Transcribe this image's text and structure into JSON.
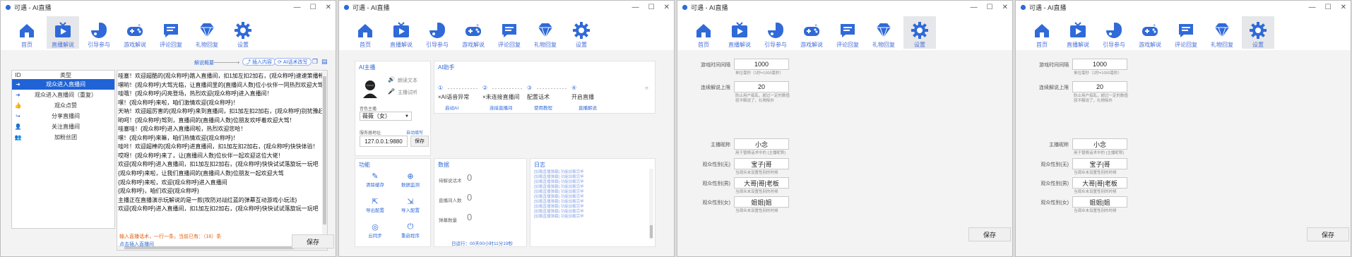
{
  "window_title": "可遇 - AI直播",
  "nav": [
    {
      "label": "首页",
      "icon": "home-icon"
    },
    {
      "label": "直播解说",
      "icon": "tv-icon"
    },
    {
      "label": "引导参与",
      "icon": "chart-icon"
    },
    {
      "label": "游戏解说",
      "icon": "gamepad-icon"
    },
    {
      "label": "评论回复",
      "icon": "comment-icon"
    },
    {
      "label": "礼物回复",
      "icon": "gem-icon"
    },
    {
      "label": "设置",
      "icon": "gear-icon"
    }
  ],
  "colors": {
    "accent": "#2f6ad8",
    "selected_row": "#1f63d6",
    "warning": "#e06010"
  },
  "w1": {
    "top_label": "解说概要",
    "insert_btn": "插入内容",
    "ai_btn": "AI话术改写",
    "col_id": "ID",
    "col_type": "类型",
    "types": [
      {
        "label": "观众进入直播间",
        "icon": "login-icon"
      },
      {
        "label": "观众进入直播间（重复）",
        "icon": "login-icon"
      },
      {
        "label": "观众点赞",
        "icon": "thumbs-up-icon"
      },
      {
        "label": "分享直播间",
        "icon": "share-icon"
      },
      {
        "label": "关注直播间",
        "icon": "follow-icon"
      },
      {
        "label": "加粉丝团",
        "icon": "fans-icon"
      }
    ],
    "lines": [
      "哇塞！欢迎超酷的{观众称呼}踏入直播间，扣1加左扣2加右，{观众称呼}速速策播畅玩",
      "嘿哟！{观众称呼}大驾光临，让直播间里的{直播间人数}位小伙伴一同热烈欢迎大驾！",
      "哇哦！{观众称呼}闪亮登场，热烈欢迎{观众称呼}进入直播间！",
      "嘿！{观众称呼}来啦，咱们激情欢迎{观众称呼}！",
      "天呐！欢迎超厉害的{观众称呼}来到直播间，扣1加左扣2加右，{观众称呼}别犹豫赶紧",
      "哟呵！{观众称呼}驾到，直播间的{直播间人数}位朋友欢呼着欢迎大驾！",
      "哇塞哇！{观众称呼}进入直播间啦，热烈欢迎您哈！",
      "嘿！{观众称呼}来嘛，咱们热情欢迎{观众称呼}！",
      "哇咔！欢迎超棒的{观众称呼}进直播间，扣1加左扣2加右，{观众称呼}快快体验！",
      "哎呀！{观众称呼}来了，让{直播间人数}位伙伴一起欢迎这位大佬！",
      "欢迎{观众称呼}进入直播间，扣1加左扣2加右，{观众称呼}快快试试落旋玩一玩吧",
      "{观众称呼}来啦，让我们直播间的{直播间人数}位朋友一起欢迎大驾",
      "{观众称呼}来啦，欢迎{观众称呼}进入直播间",
      "{观众称呼}，咱们欢迎{观众称呼}",
      "主播正在直播演示玩解说的是一款{攻防对战红蓝的弹幕互动游戏小玩法}",
      "欢迎{观众称呼}进入直播间，扣1加左扣2加右，{观众称呼}快快试试落旋玩一玩吧"
    ],
    "note1": "输入直播话术，一行一条。当前已有：（16）条",
    "note2": "点击插入直播间",
    "save": "保存"
  },
  "w2": {
    "ai_host_title": "AI主播",
    "host_opt1": "朗读文本",
    "host_opt2": "主播试听",
    "voice_label": "音色主播",
    "voice_value": "薇薇（女）",
    "server_label": "服务器地址",
    "server_link": "自动填写",
    "server_value": "127.0.0.1:9880",
    "server_save": "保存",
    "assistant_title": "AI助手",
    "steps": [
      {
        "num": "①",
        "label": "×AI语音异常",
        "link": "启动AI"
      },
      {
        "num": "②",
        "label": "×未连接直播间",
        "link": "连接直播间"
      },
      {
        "num": "③",
        "label": "配置话术",
        "link": "使用教程"
      },
      {
        "num": "④",
        "label": "开启直播",
        "link": "直播解说"
      }
    ],
    "func_title": "功能",
    "funcs": [
      {
        "label": "清除缓存",
        "icon": "broom-icon"
      },
      {
        "label": "数据监测",
        "icon": "monitor-icon"
      },
      {
        "label": "导出配置",
        "icon": "export-icon"
      },
      {
        "label": "导入配置",
        "icon": "import-icon"
      },
      {
        "label": "云同步",
        "icon": "wifi-icon"
      },
      {
        "label": "重启程序",
        "icon": "power-icon"
      }
    ],
    "data_title": "数据",
    "data": [
      {
        "label": "待解说话术",
        "value": "0"
      },
      {
        "label": "直播间人数",
        "value": "0"
      },
      {
        "label": "弹幕数量",
        "value": "0"
      }
    ],
    "date_text": "日运行：00天00小时11分19秒",
    "log_title": "日志",
    "log_lines": [
      "[加载直播弹幕] 功能加载完毕",
      "[加载直播弹幕] 功能加载完毕",
      "[加载直播弹幕] 功能加载完毕",
      "[加载直播弹幕] 功能加载完毕",
      "[加载直播弹幕] 功能加载完毕",
      "[加载直播弹幕] 功能加载完毕",
      "[加载直播弹幕] 功能加载完毕",
      "[加载直播弹幕] 功能加载完毕",
      "[加载直播弹幕] 功能加载完毕",
      "[加载直播弹幕] 功能加载完毕"
    ]
  },
  "settings": {
    "interval_label": "游戏时间间隔",
    "interval_value": "1000",
    "interval_hint": "单位毫秒（1秒=1000毫秒）",
    "limit_label": "连续解说上限",
    "limit_value": "20",
    "limit_hint1": "防止用户捣乱，超过一定的数值",
    "limit_hint2": "就不解说了，礼物除外",
    "host_label": "主播昵称",
    "host_value": "小念",
    "host_hint": "用于替换话术中的 {主播昵称}",
    "g1_label": "观众性别(无)",
    "g1_value": "宝子|哥",
    "g1_hint": "当观众未设置性别的时候",
    "g2_label": "观众性别(男)",
    "g2_value": "大哥|哥|老板",
    "g2_hint": "当观众未设置性别的时候",
    "g3_label": "观众性别(女)",
    "g3_value": "姐姐|姐",
    "g3_hint": "当观众未设置性别的时候",
    "save": "保存"
  }
}
